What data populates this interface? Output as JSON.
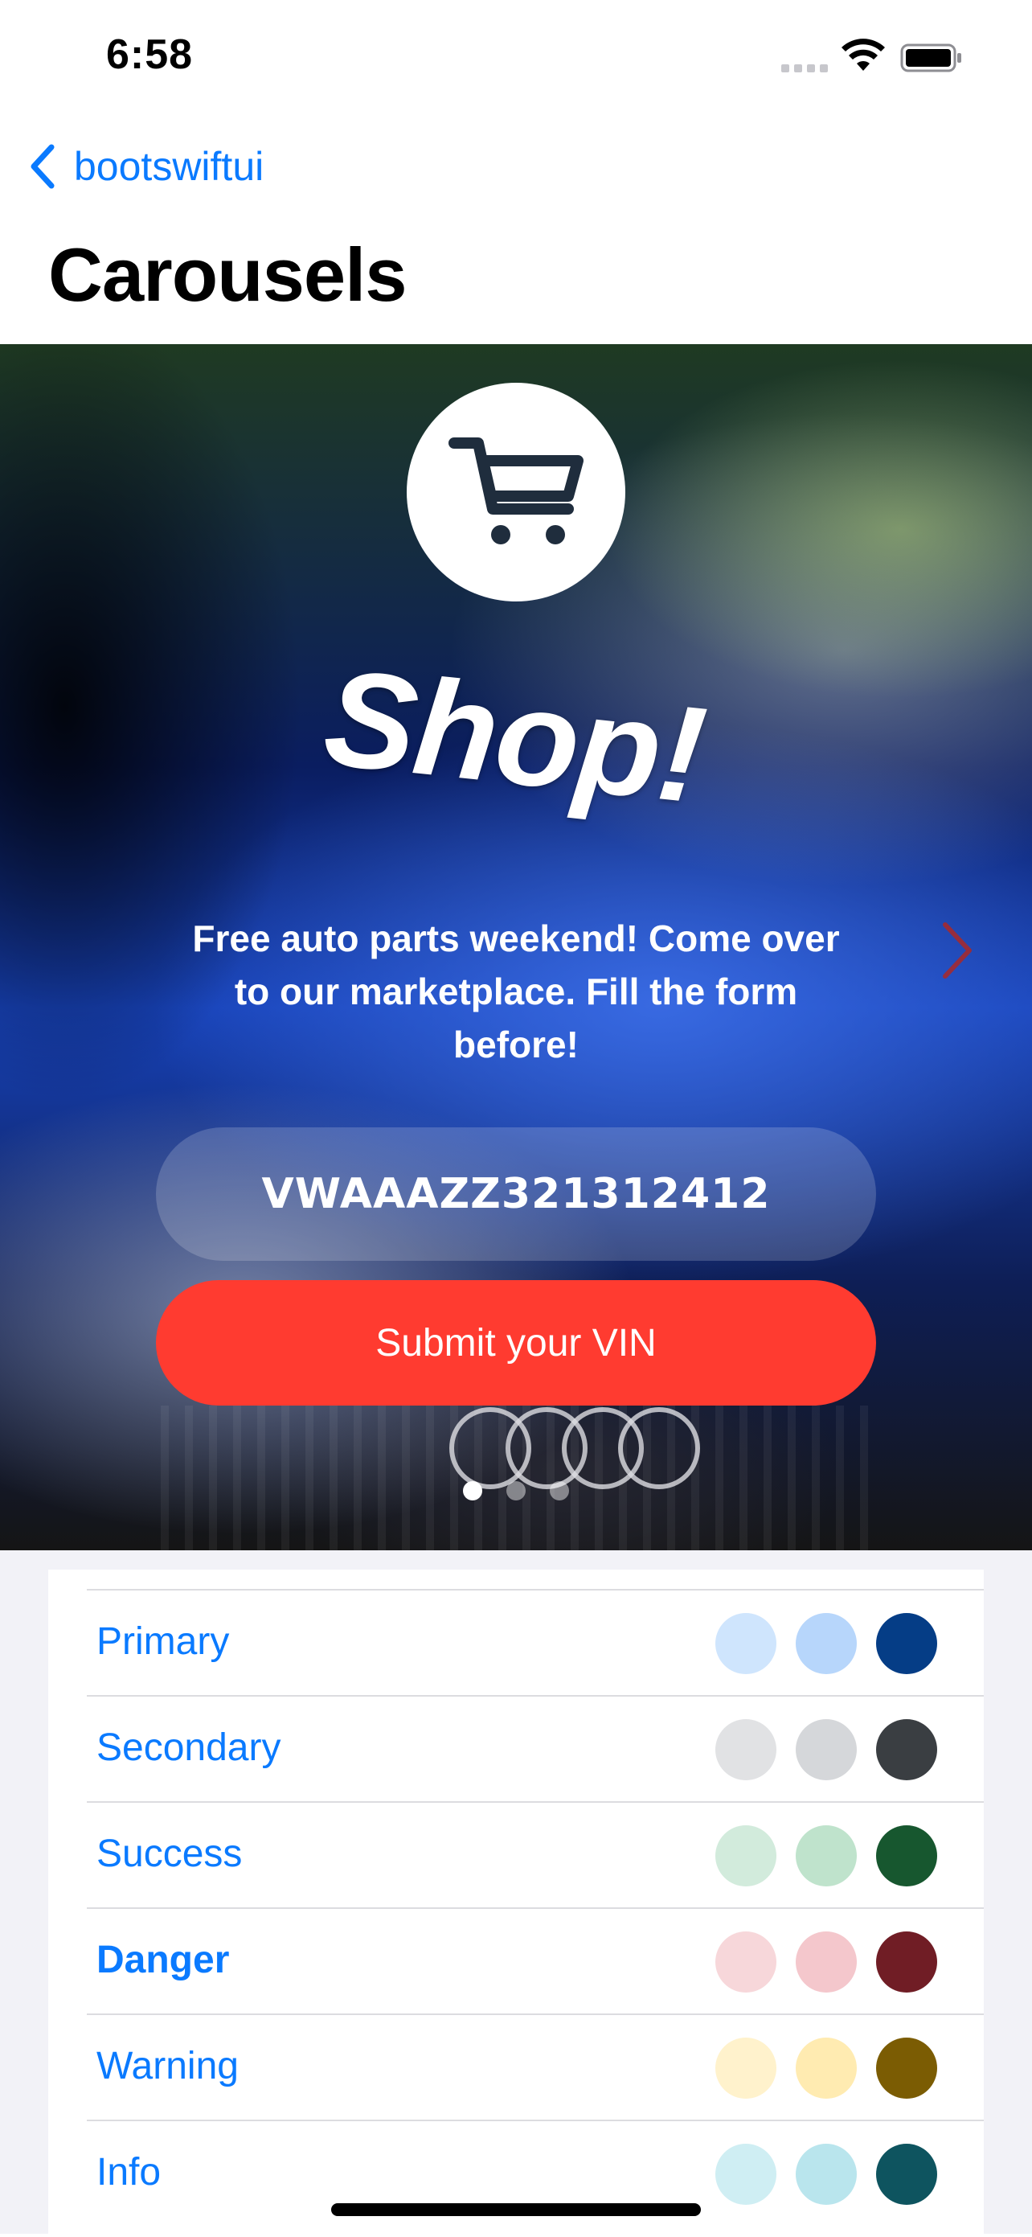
{
  "status_bar": {
    "time": "6:58"
  },
  "nav": {
    "back_label": "bootswiftui",
    "title": "Carousels"
  },
  "carousel": {
    "headline": "Shop!",
    "text": "Free auto parts weekend! Come over to our marketplace. Fill the form before!",
    "vin_value": "VWAAAZZ321312412",
    "submit_label": "Submit your VIN",
    "page_count": 3,
    "active_page": 1,
    "icons": {
      "cart": "cart-icon",
      "next": "chevron-right-icon"
    }
  },
  "color_list": {
    "rows": [
      {
        "label": "Primary",
        "bold": false,
        "swatches": [
          "#cfe5fd",
          "#b7d6fb",
          "#053d86"
        ]
      },
      {
        "label": "Secondary",
        "bold": false,
        "swatches": [
          "#e1e2e4",
          "#d5d7da",
          "#3a3e42"
        ]
      },
      {
        "label": "Success",
        "bold": false,
        "swatches": [
          "#d2ebdc",
          "#bfe3cc",
          "#17572f"
        ]
      },
      {
        "label": "Danger",
        "bold": true,
        "swatches": [
          "#f7d7da",
          "#f4c7cc",
          "#701d25"
        ]
      },
      {
        "label": "Warning",
        "bold": false,
        "swatches": [
          "#fff2cc",
          "#ffebb1",
          "#7b5c03"
        ]
      },
      {
        "label": "Info",
        "bold": false,
        "swatches": [
          "#cfeef3",
          "#b9e5ed",
          "#0e545f"
        ]
      }
    ]
  },
  "colors": {
    "accent": "#0a7aff",
    "submit": "#ff3b30",
    "list_background": "#f2f2f7"
  }
}
